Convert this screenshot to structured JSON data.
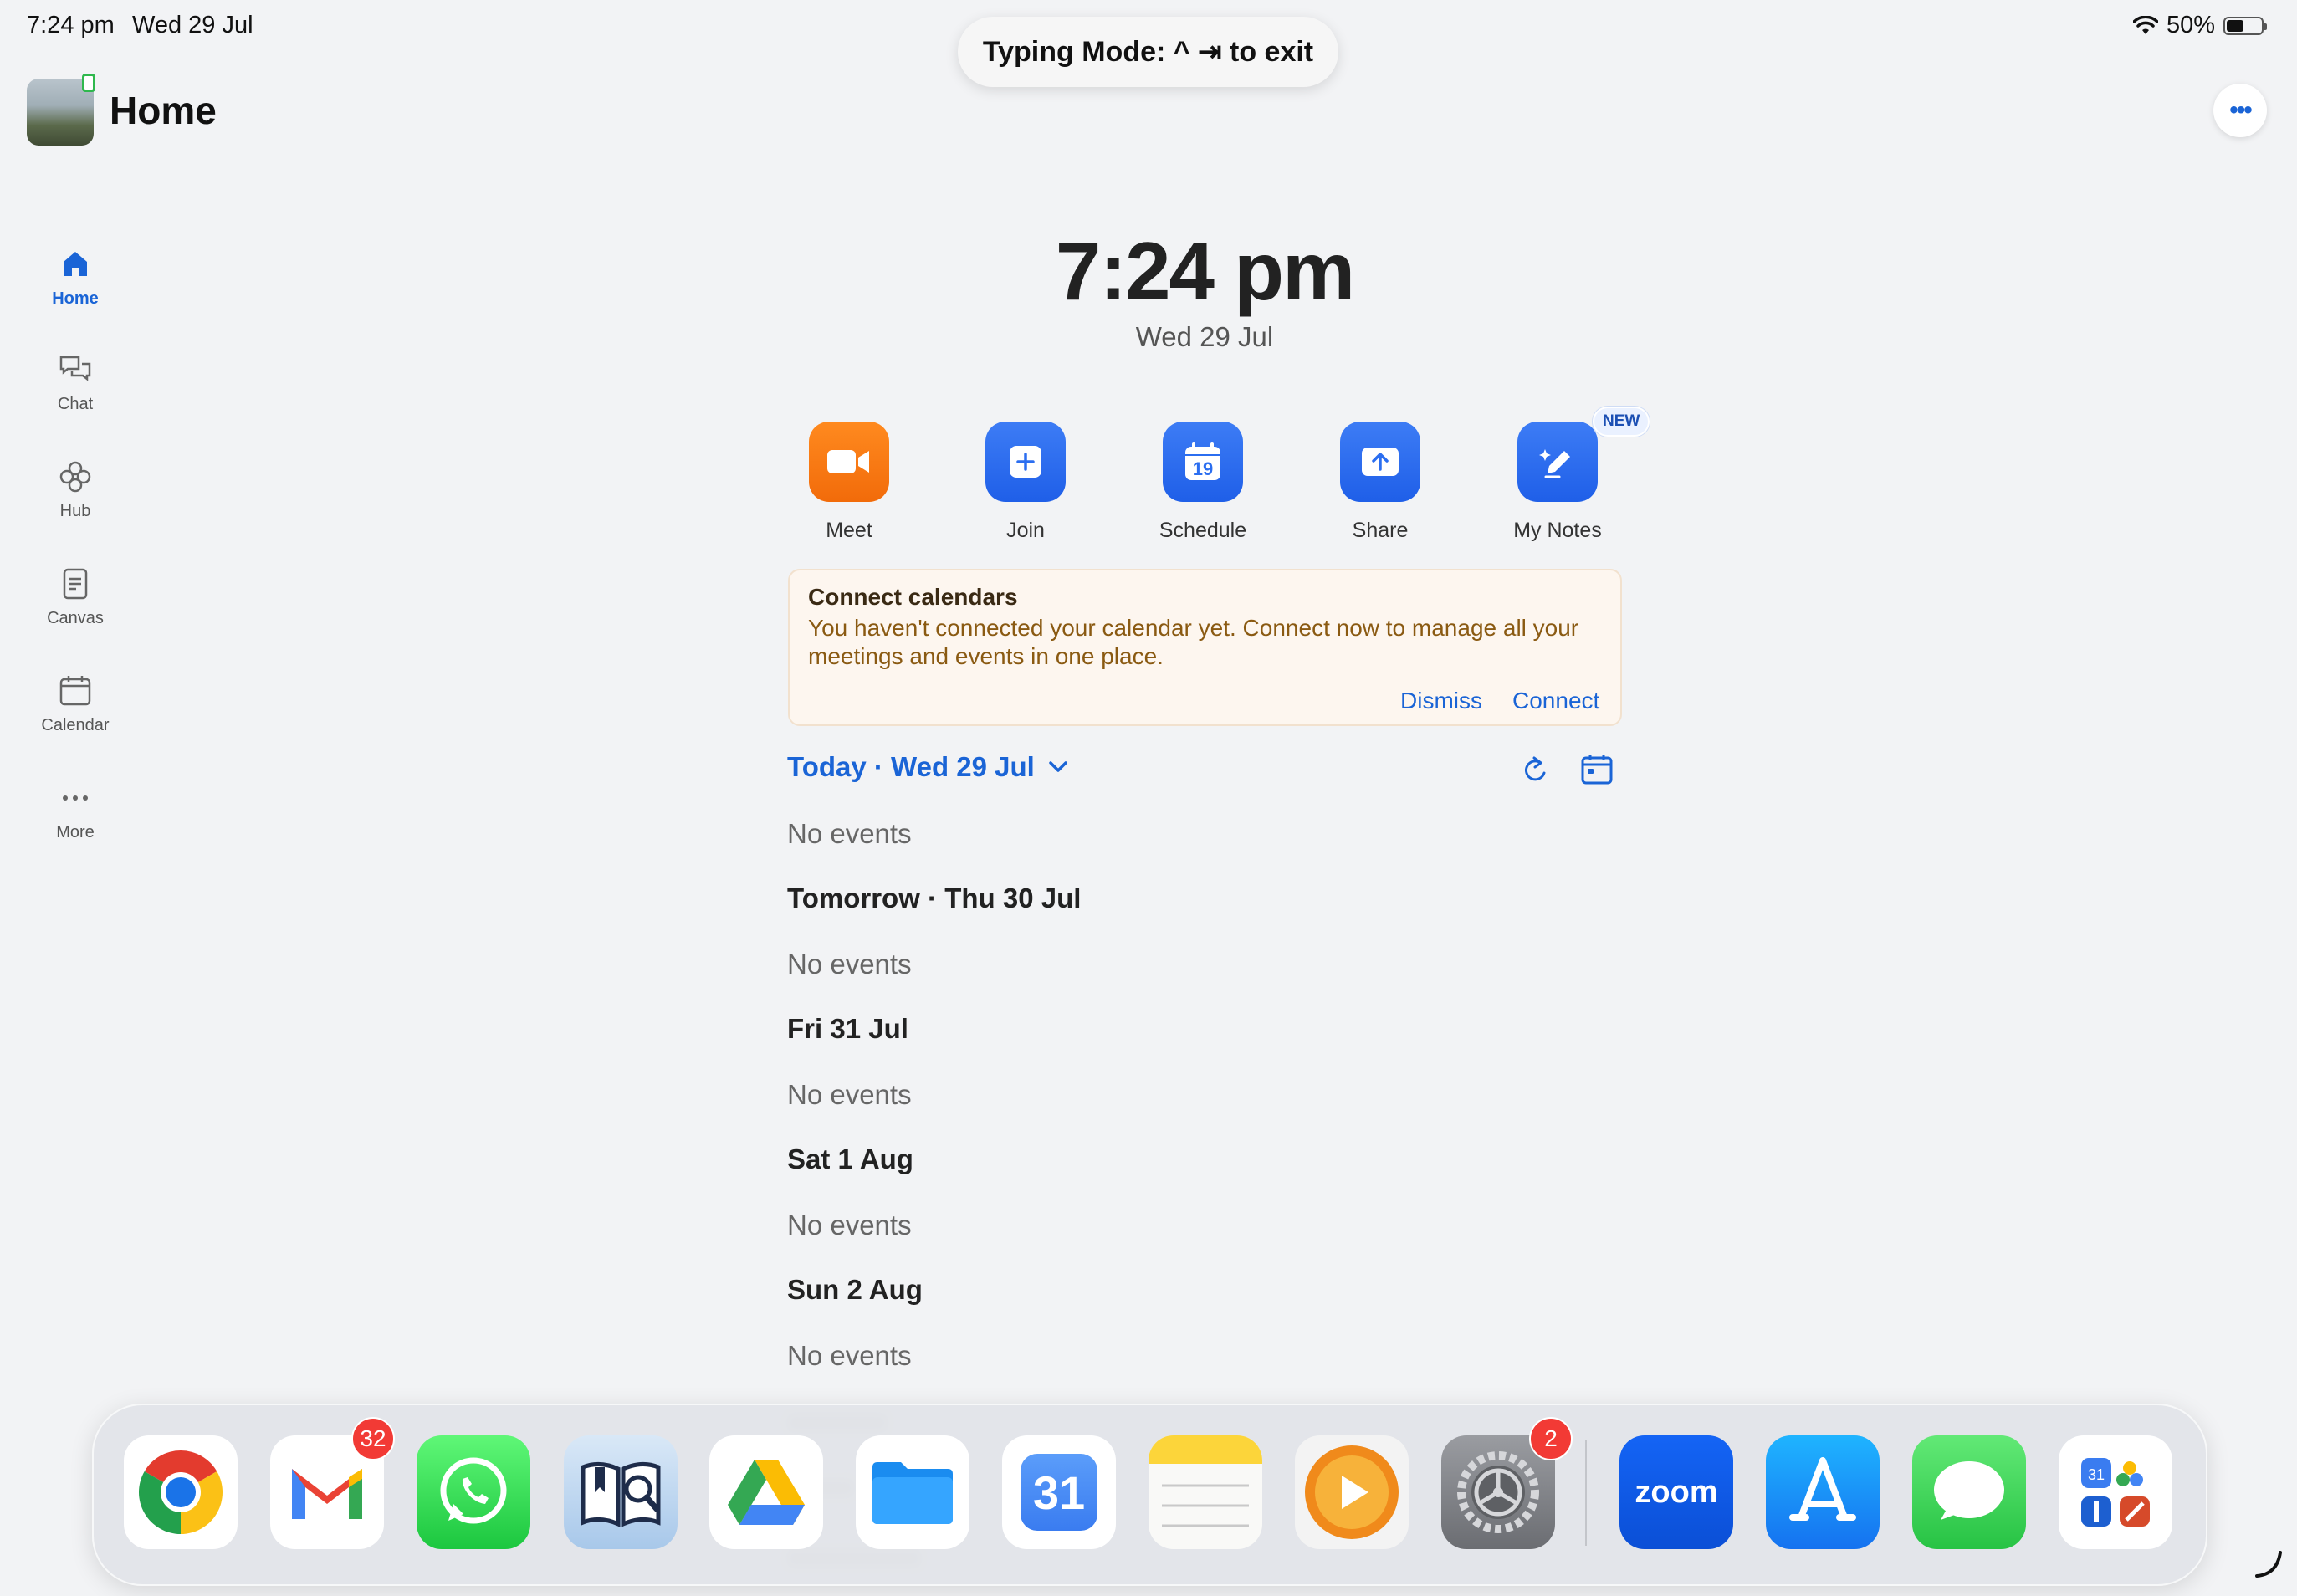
{
  "status_bar": {
    "time": "7:24 pm",
    "date": "Wed 29 Jul",
    "battery": "50%"
  },
  "typing_mode": {
    "text": "Typing Mode: ^ ⇥ to exit"
  },
  "header": {
    "title": "Home"
  },
  "sidebar": {
    "items": [
      {
        "label": "Home",
        "icon": "home-icon",
        "active": true
      },
      {
        "label": "Chat",
        "icon": "chat-icon"
      },
      {
        "label": "Hub",
        "icon": "hub-icon"
      },
      {
        "label": "Canvas",
        "icon": "canvas-icon"
      },
      {
        "label": "Calendar",
        "icon": "calendar-icon"
      },
      {
        "label": "More",
        "icon": "more-icon"
      }
    ]
  },
  "clock": {
    "time": "7:24 pm",
    "date": "Wed 29 Jul"
  },
  "actions": [
    {
      "label": "Meet",
      "icon": "video-camera-icon",
      "color": "#f57a12"
    },
    {
      "label": "Join",
      "icon": "plus-icon",
      "color": "#2b6ef0"
    },
    {
      "label": "Schedule",
      "icon": "calendar-19-icon",
      "color": "#2b6ef0",
      "calendar_day": "19"
    },
    {
      "label": "Share",
      "icon": "share-upload-icon",
      "color": "#2b6ef0"
    },
    {
      "label": "My Notes",
      "icon": "notes-pen-icon",
      "color": "#2b6ef0",
      "badge": "NEW"
    }
  ],
  "connect_calendars": {
    "title": "Connect calendars",
    "description": "You haven't connected your calendar yet. Connect now to manage all your meetings and events in one place.",
    "dismiss": "Dismiss",
    "connect": "Connect"
  },
  "agenda": {
    "today_label": "Today · Wed 29 Jul",
    "days": [
      {
        "label": "",
        "events": "No events"
      },
      {
        "label": "Tomorrow · Thu 30 Jul",
        "events": "No events"
      },
      {
        "label": "Fri 31 Jul",
        "events": "No events"
      },
      {
        "label": "Sat 1 Aug",
        "events": "No events"
      },
      {
        "label": "Sun 2 Aug",
        "events": "No events"
      }
    ]
  },
  "dock": {
    "apps": [
      {
        "name": "Chrome"
      },
      {
        "name": "Gmail",
        "badge": "32"
      },
      {
        "name": "WhatsApp"
      },
      {
        "name": "Dictionary"
      },
      {
        "name": "Google Drive"
      },
      {
        "name": "Files"
      },
      {
        "name": "Calendar",
        "day": "31"
      },
      {
        "name": "Notes"
      },
      {
        "name": "Infuse"
      },
      {
        "name": "Settings",
        "badge": "2"
      },
      {
        "name": "Zoom",
        "text": "zoom"
      },
      {
        "name": "App Store"
      },
      {
        "name": "Messages"
      },
      {
        "name": "App Library"
      }
    ]
  },
  "colors": {
    "accent": "#1a64d6",
    "meet_orange": "#f57a12",
    "badge_red": "#f23a35"
  }
}
